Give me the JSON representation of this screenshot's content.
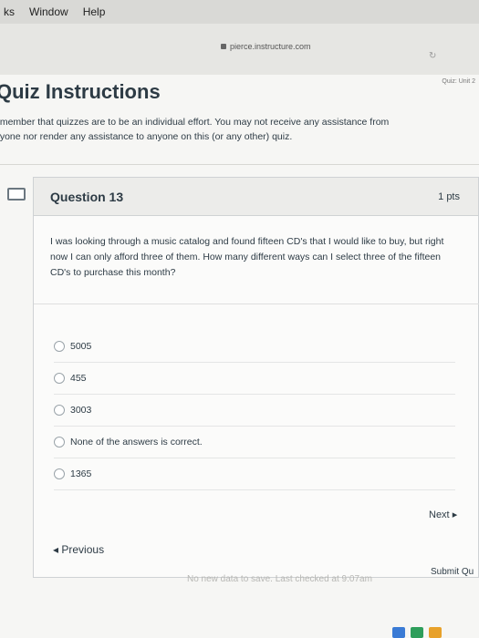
{
  "menubar": {
    "items": [
      "ks",
      "Window",
      "Help"
    ]
  },
  "browser": {
    "url": "pierce.instructure.com"
  },
  "page": {
    "breadcrumb": "Quiz: Unit 2",
    "title": "Quiz Instructions",
    "instructions_line1": "emember that quizzes are to be an individual effort. You may not receive any assistance from",
    "instructions_line2": "nyone nor render any assistance to anyone on this (or any other) quiz."
  },
  "question": {
    "name": "Question 13",
    "points": "1 pts",
    "text": "I was looking through a music catalog and found fifteen CD's that I would like to buy, but right now I can only afford three of them. How many different ways can I select three of the fifteen CD's to purchase this month?",
    "answers": [
      "5005",
      "455",
      "3003",
      "None of the answers is correct.",
      "1365"
    ]
  },
  "nav": {
    "next": "Next",
    "previous": "Previous",
    "status": "No new data to save. Last checked at 9:07am",
    "submit": "Submit Qu"
  }
}
